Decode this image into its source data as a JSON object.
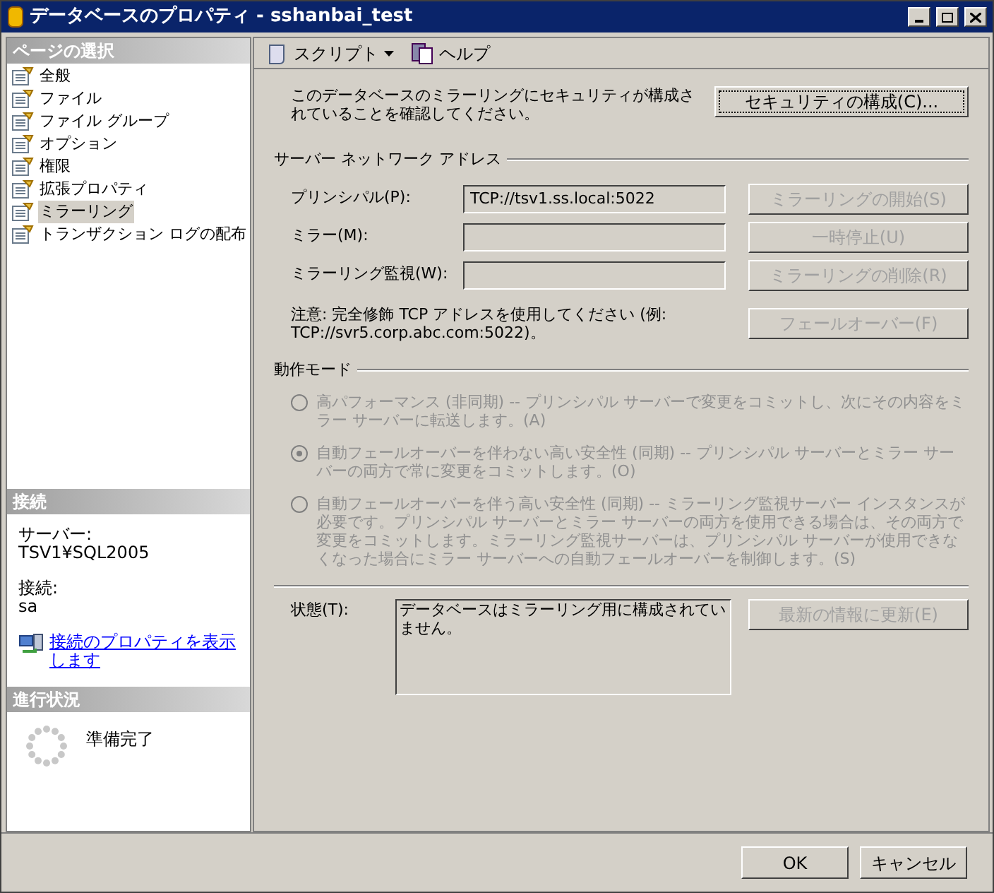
{
  "window": {
    "title": "データベースのプロパティ - sshanbai_test"
  },
  "sidebar": {
    "header": "ページの選択",
    "items": [
      {
        "label": "全般",
        "selected": false
      },
      {
        "label": "ファイル",
        "selected": false
      },
      {
        "label": "ファイル グループ",
        "selected": false
      },
      {
        "label": "オプション",
        "selected": false
      },
      {
        "label": "権限",
        "selected": false
      },
      {
        "label": "拡張プロパティ",
        "selected": false
      },
      {
        "label": "ミラーリング",
        "selected": true
      },
      {
        "label": "トランザクション ログの配布",
        "selected": false
      }
    ]
  },
  "connection": {
    "header": "接続",
    "server_label": "サーバー:",
    "server": "TSV1¥SQL2005",
    "connection_label": "接続:",
    "user": "sa",
    "link": "接続のプロパティを表示します"
  },
  "progress": {
    "header": "進行状況",
    "status": "準備完了"
  },
  "toolbar": [
    {
      "label": "スクリプト",
      "kind": "dropdown"
    },
    {
      "label": "ヘルプ",
      "kind": "help"
    }
  ],
  "security": {
    "note": "このデータベースのミラーリングにセキュリティが構成されていることを確認してください。",
    "button": {
      "label": "セキュリティの構成(C)...",
      "disabled": false
    }
  },
  "network": {
    "title": "サーバー ネットワーク アドレス",
    "fields": [
      {
        "label": "プリンシパル(P):",
        "value": "TCP://tsv1.ss.local:5022",
        "button": {
          "label": "ミラーリングの開始(S)",
          "disabled": true
        }
      },
      {
        "label": "ミラー(M):",
        "button": {
          "label": "一時停止(U)",
          "disabled": true
        }
      },
      {
        "label": "ミラーリング監視(W):",
        "button": {
          "label": "ミラーリングの削除(R)",
          "disabled": true
        }
      }
    ],
    "note": "注意: 完全修飾 TCP アドレスを使用してください (例: TCP://svr5.corp.abc.com:5022)。",
    "failover": {
      "label": "フェールオーバー(F)",
      "disabled": true
    }
  },
  "mode": {
    "title": "動作モード",
    "options": [
      {
        "label": "高パフォーマンス (非同期) -- プリンシパル サーバーで変更をコミットし、次にその内容をミラー サーバーに転送します。(A)",
        "selected": false,
        "disabled": true
      },
      {
        "label": "自動フェールオーバーを伴わない高い安全性 (同期) -- プリンシパル サーバーとミラー サーバーの両方で常に変更をコミットします。(O)",
        "selected": true,
        "disabled": true
      },
      {
        "label": "自動フェールオーバーを伴う高い安全性 (同期) -- ミラーリング監視サーバー インスタンスが必要です。プリンシパル サーバーとミラー サーバーの両方を使用できる場合は、その両方で変更をコミットします。ミラーリング監視サーバーは、プリンシパル サーバーが使用できなくなった場合にミラー サーバーへの自動フェールオーバーを制御します。(S)",
        "selected": false,
        "disabled": true
      }
    ]
  },
  "status": {
    "label": "状態(T):",
    "value": "データベースはミラーリング用に構成されていません。",
    "button": {
      "label": "最新の情報に更新(E)",
      "disabled": true
    }
  },
  "footer": [
    "OK",
    "キャンセル"
  ]
}
